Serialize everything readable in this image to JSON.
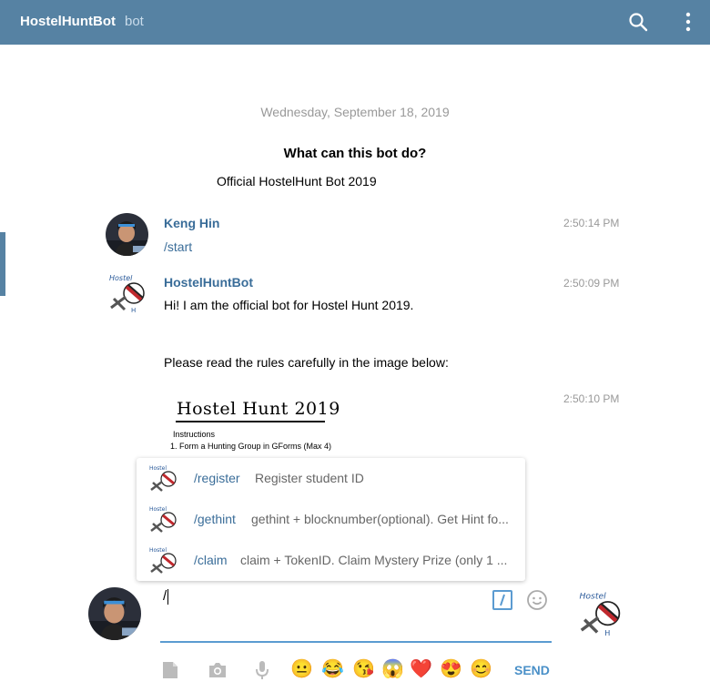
{
  "header": {
    "title": "HostelHuntBot",
    "subtitle": "bot"
  },
  "chat": {
    "date": "Wednesday, September 18, 2019",
    "bot_question": "What can this bot do?",
    "bot_description": "Official HostelHunt Bot 2019",
    "messages": [
      {
        "sender": "Keng Hin",
        "time": "2:50:14 PM",
        "text": "/start"
      },
      {
        "sender": "HostelHuntBot",
        "time": "2:50:09 PM",
        "line1": "Hi! I am the official bot for Hostel Hunt 2019.",
        "line2": "Please read the rules carefully in the image below:"
      },
      {
        "time": "2:50:10 PM",
        "image": {
          "title": "Hostel Hunt 2019",
          "sub1": "Instructions",
          "sub2": "1. Form a Hunting Group in GForms (Max 4)"
        }
      }
    ]
  },
  "commands": [
    {
      "cmd": "/register",
      "desc": "Register student ID"
    },
    {
      "cmd": "/gethint",
      "desc": "gethint + blocknumber(optional). Get Hint fo..."
    },
    {
      "cmd": "/claim",
      "desc": "claim + TokenID. Claim Mystery Prize (only 1 ..."
    }
  ],
  "composer": {
    "value": "/",
    "emojis": [
      "😐",
      "😂",
      "😘",
      "😱",
      "❤️",
      "😍",
      "😊"
    ],
    "send_label": "SEND"
  },
  "icons": {
    "search": "search-icon",
    "more": "more-vertical-icon",
    "attach": "file-icon",
    "camera": "camera-icon",
    "mic": "microphone-icon",
    "commands": "slash-command-icon",
    "emoji": "smiley-icon"
  },
  "colors": {
    "header_bg": "#5682a3",
    "link": "#3a6d99",
    "accent": "#5b9bd1",
    "send": "#4a90c8"
  }
}
